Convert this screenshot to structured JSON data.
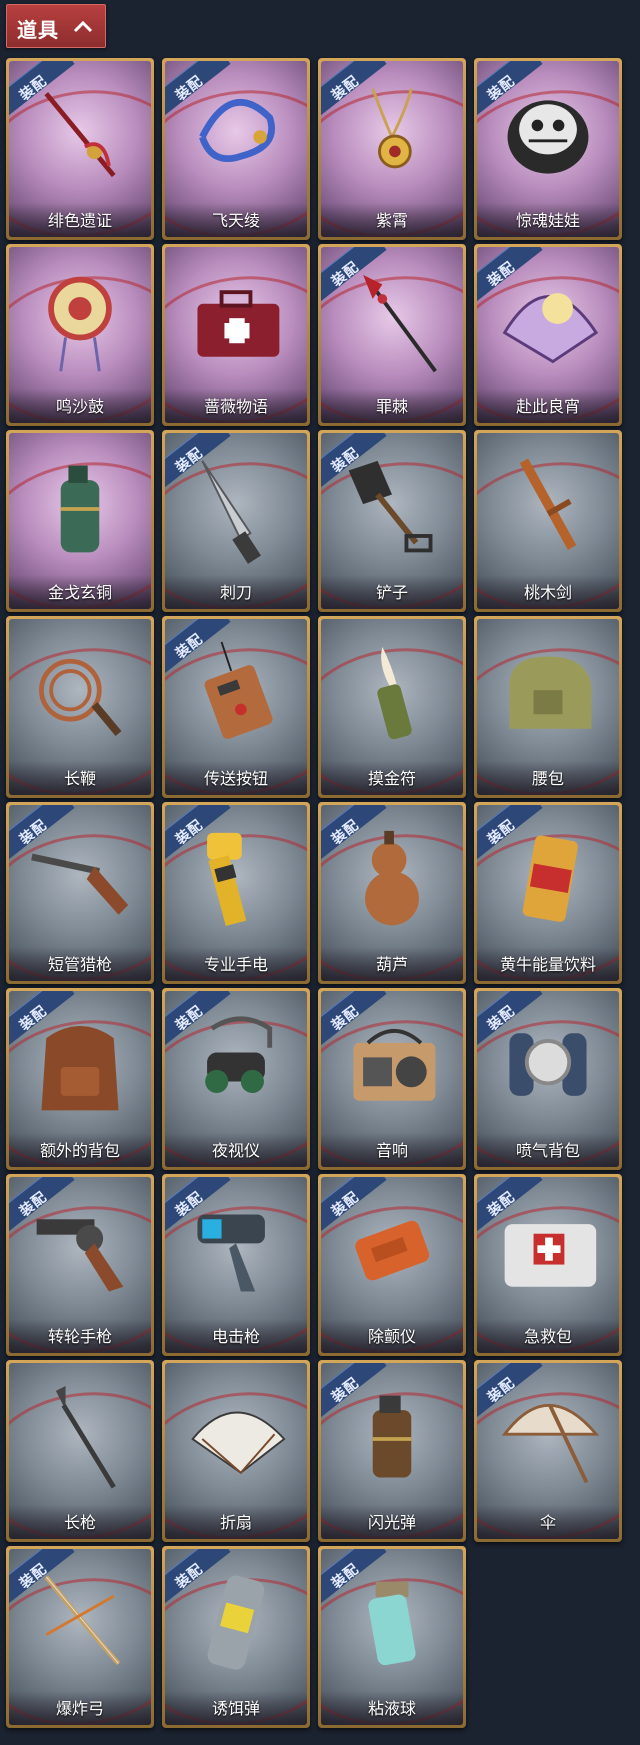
{
  "header": {
    "title": "道具"
  },
  "equip_badge": "装配",
  "items": [
    {
      "name": "绯色遗证",
      "bg": "purple",
      "equipped": true,
      "icon": "sword-icon"
    },
    {
      "name": "飞天绫",
      "bg": "purple",
      "equipped": true,
      "icon": "ribbon-icon"
    },
    {
      "name": "紫霄",
      "bg": "purple",
      "equipped": true,
      "icon": "pendant-icon"
    },
    {
      "name": "惊魂娃娃",
      "bg": "purple",
      "equipped": true,
      "icon": "doll-icon"
    },
    {
      "name": "鸣沙鼓",
      "bg": "purple",
      "equipped": false,
      "icon": "drum-icon"
    },
    {
      "name": "蔷薇物语",
      "bg": "purple",
      "equipped": false,
      "icon": "medkit-icon"
    },
    {
      "name": "罪棘",
      "bg": "purple",
      "equipped": true,
      "icon": "spear-icon"
    },
    {
      "name": "赴此良宵",
      "bg": "purple",
      "equipped": true,
      "icon": "fan-icon"
    },
    {
      "name": "金戈玄铜",
      "bg": "purple",
      "equipped": false,
      "icon": "grenade-icon"
    },
    {
      "name": "刺刀",
      "bg": "gray",
      "equipped": true,
      "icon": "knife-icon"
    },
    {
      "name": "铲子",
      "bg": "gray",
      "equipped": true,
      "icon": "shovel-icon"
    },
    {
      "name": "桃木剑",
      "bg": "gray",
      "equipped": false,
      "icon": "wooden-sword-icon"
    },
    {
      "name": "长鞭",
      "bg": "gray",
      "equipped": false,
      "icon": "whip-icon"
    },
    {
      "name": "传送按钮",
      "bg": "gray",
      "equipped": true,
      "icon": "remote-icon"
    },
    {
      "name": "摸金符",
      "bg": "gray",
      "equipped": false,
      "icon": "talisman-icon"
    },
    {
      "name": "腰包",
      "bg": "gray",
      "equipped": false,
      "icon": "bag-icon"
    },
    {
      "name": "短管猎枪",
      "bg": "gray",
      "equipped": true,
      "icon": "shotgun-icon"
    },
    {
      "name": "专业手电",
      "bg": "gray",
      "equipped": true,
      "icon": "flashlight-icon"
    },
    {
      "name": "葫芦",
      "bg": "gray",
      "equipped": true,
      "icon": "gourd-icon"
    },
    {
      "name": "黄牛能量饮料",
      "bg": "gray",
      "equipped": true,
      "icon": "can-icon"
    },
    {
      "name": "额外的背包",
      "bg": "gray",
      "equipped": true,
      "icon": "backpack-icon"
    },
    {
      "name": "夜视仪",
      "bg": "gray",
      "equipped": true,
      "icon": "goggles-icon"
    },
    {
      "name": "音响",
      "bg": "gray",
      "equipped": true,
      "icon": "radio-icon"
    },
    {
      "name": "喷气背包",
      "bg": "gray",
      "equipped": true,
      "icon": "jetpack-icon"
    },
    {
      "name": "转轮手枪",
      "bg": "gray",
      "equipped": true,
      "icon": "revolver-icon"
    },
    {
      "name": "电击枪",
      "bg": "gray",
      "equipped": true,
      "icon": "stun-gun-icon"
    },
    {
      "name": "除颤仪",
      "bg": "gray",
      "equipped": true,
      "icon": "defibrillator-icon"
    },
    {
      "name": "急救包",
      "bg": "gray",
      "equipped": true,
      "icon": "first-aid-icon"
    },
    {
      "name": "长枪",
      "bg": "gray",
      "equipped": false,
      "icon": "long-spear-icon"
    },
    {
      "name": "折扇",
      "bg": "gray",
      "equipped": false,
      "icon": "folding-fan-icon"
    },
    {
      "name": "闪光弹",
      "bg": "gray",
      "equipped": true,
      "icon": "flashbang-icon"
    },
    {
      "name": "伞",
      "bg": "gray",
      "equipped": true,
      "icon": "umbrella-icon"
    },
    {
      "name": "爆炸弓",
      "bg": "gray",
      "equipped": true,
      "icon": "bow-icon"
    },
    {
      "name": "诱饵弹",
      "bg": "gray",
      "equipped": true,
      "icon": "decoy-icon"
    },
    {
      "name": "粘液球",
      "bg": "gray",
      "equipped": true,
      "icon": "slime-ball-icon"
    }
  ]
}
